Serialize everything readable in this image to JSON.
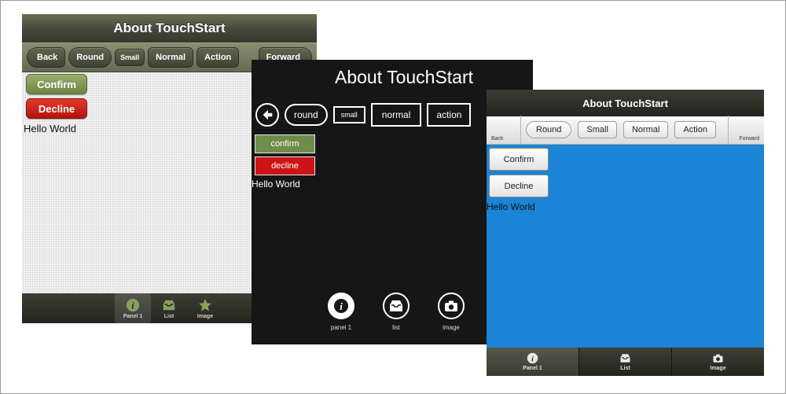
{
  "screen_olive": {
    "title": "About TouchStart",
    "toolbar": {
      "back": "Back",
      "round": "Round",
      "small": "Small",
      "normal": "Normal",
      "action": "Action",
      "forward": "Forward"
    },
    "confirm": "Confirm",
    "decline": "Decline",
    "hello": "Hello World",
    "tabs": [
      {
        "label": "Panel 1",
        "icon": "info-icon"
      },
      {
        "label": "List",
        "icon": "inbox-icon"
      },
      {
        "label": "Image",
        "icon": "star-icon"
      }
    ]
  },
  "screen_dark": {
    "title": "About TouchStart",
    "toolbar": {
      "round": "round",
      "small": "small",
      "normal": "normal",
      "action": "action"
    },
    "confirm": "confirm",
    "decline": "decline",
    "hello": "Hello World",
    "tabs": [
      {
        "label": "panel 1",
        "icon": "info-icon"
      },
      {
        "label": "list",
        "icon": "inbox-icon"
      },
      {
        "label": "image",
        "icon": "camera-icon"
      }
    ]
  },
  "screen_blue": {
    "title": "About TouchStart",
    "toolbar": {
      "back": "Back",
      "round": "Round",
      "small": "Small",
      "normal": "Normal",
      "action": "Action",
      "forward": "Forward"
    },
    "confirm": "Confirm",
    "decline": "Decline",
    "hello": "Hello World",
    "tabs": [
      {
        "label": "Panel 1",
        "icon": "info-icon"
      },
      {
        "label": "List",
        "icon": "inbox-icon"
      },
      {
        "label": "Image",
        "icon": "camera-icon"
      }
    ]
  },
  "colors": {
    "olive_confirm": "#6c8544",
    "decline_red": "#cc1416",
    "blue_background": "#1a84d6",
    "dark_background": "#161616"
  }
}
